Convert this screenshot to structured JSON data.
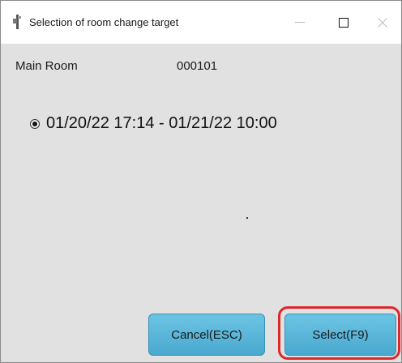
{
  "window": {
    "title": "Selection of room change target",
    "min_icon": "minimize-icon",
    "max_icon": "maximize-icon",
    "close_icon": "close-icon"
  },
  "room": {
    "label": "Main Room",
    "value": "000101"
  },
  "options": [
    {
      "label": "01/20/22 17:14 - 01/21/22 10:00",
      "selected": true
    }
  ],
  "buttons": {
    "cancel_label": "Cancel(ESC)",
    "select_label": "Select(F9)"
  },
  "colors": {
    "button_fill": "#5ab7db",
    "highlight": "#e0262a",
    "background": "#e1e1e1"
  }
}
